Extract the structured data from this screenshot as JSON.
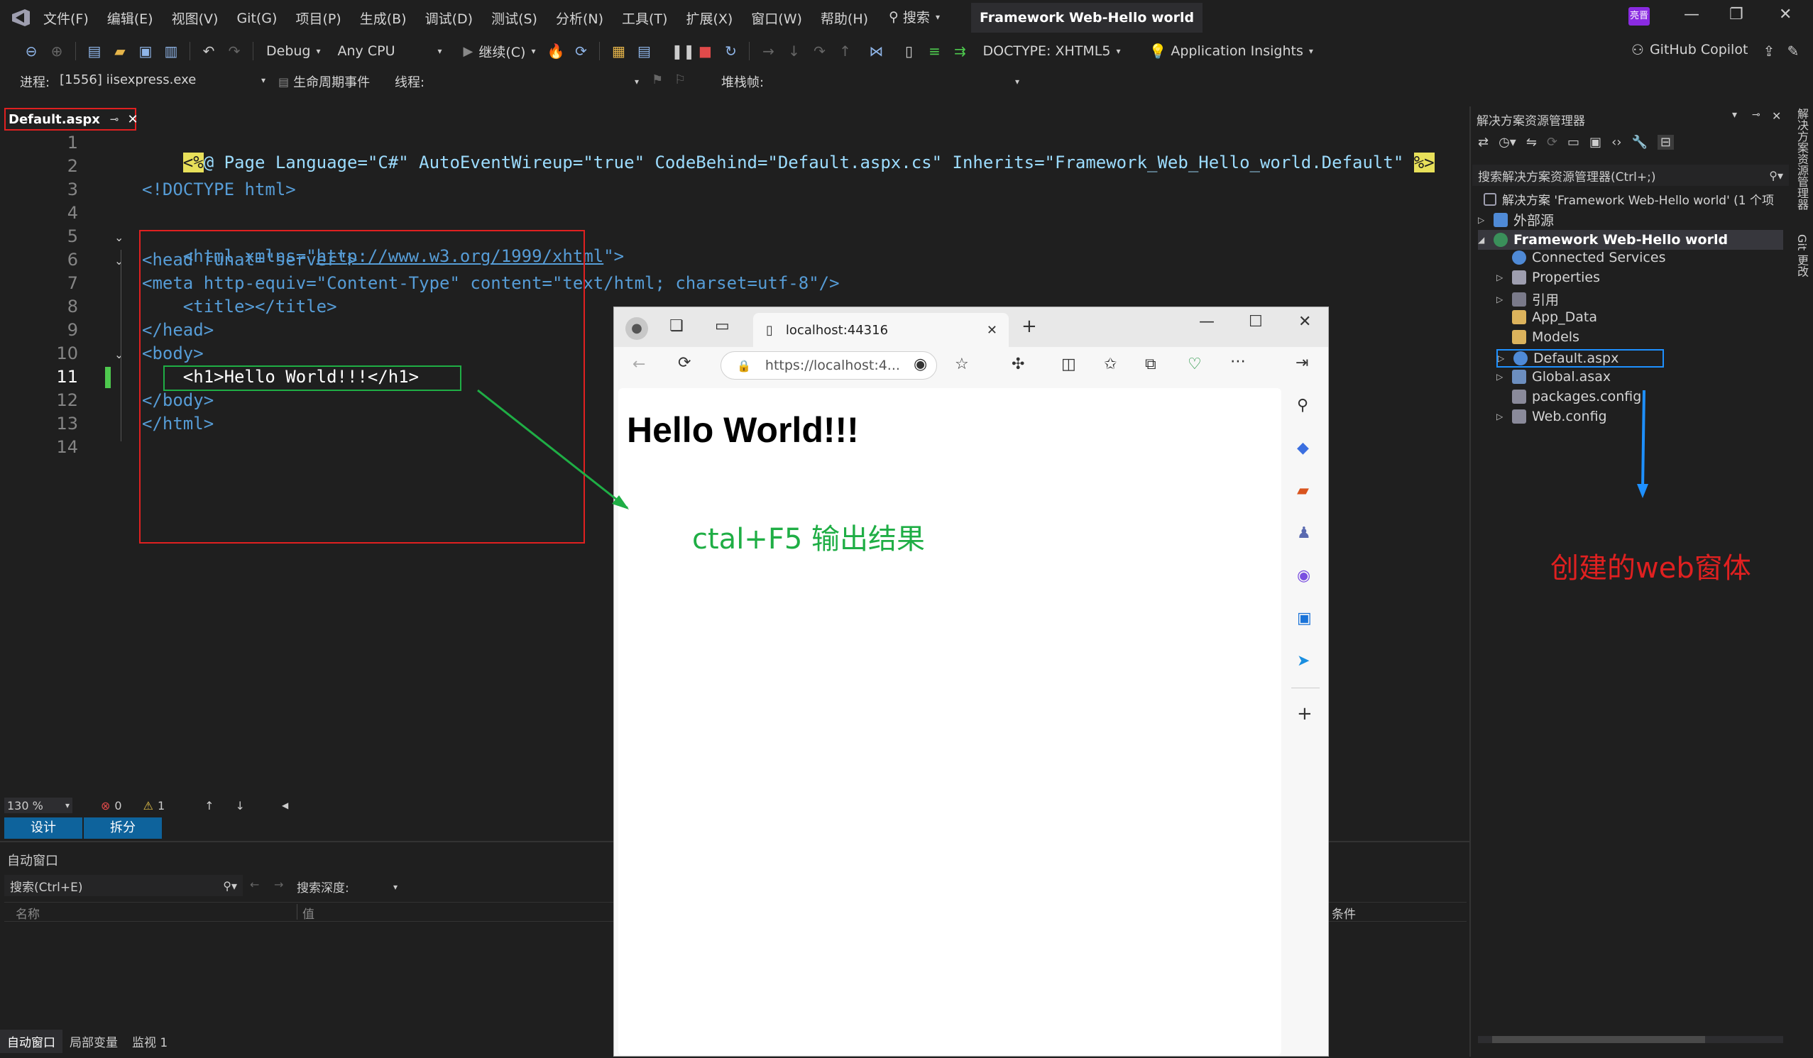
{
  "app": {
    "menu": [
      "文件(F)",
      "编辑(E)",
      "视图(V)",
      "Git(G)",
      "项目(P)",
      "生成(B)",
      "调试(D)",
      "测试(S)",
      "分析(N)",
      "工具(T)",
      "扩展(X)",
      "窗口(W)",
      "帮助(H)"
    ],
    "search_label": "搜索",
    "solution_title": "Framework Web-Hello world",
    "user_badge": "亮晋"
  },
  "toolbar": {
    "config": "Debug",
    "platform": "Any CPU",
    "continue": "继续(C)",
    "doctype": "DOCTYPE: XHTML5",
    "app_insights": "Application Insights",
    "copilot": "GitHub Copilot"
  },
  "debug_bar": {
    "process_label": "进程:",
    "process_value": "[1556] iisexpress.exe",
    "lifecycle": "生命周期事件",
    "thread_label": "线程:",
    "stack_label": "堆栈帧:"
  },
  "editor": {
    "tab_name": "Default.aspx",
    "line_numbers": [
      "1",
      "2",
      "3",
      "4",
      "5",
      "6",
      "7",
      "8",
      "9",
      "10",
      "11",
      "12",
      "13",
      "14"
    ],
    "current_line": "11",
    "lines": {
      "l1_open": "<%",
      "l1_rest": "@ Page Language=\"C#\" AutoEventWireup=\"true\" CodeBehind=\"Default.aspx.cs\" Inherits=\"Framework_Web_Hello_world.Default\" ",
      "l1_close": "%>",
      "l3": "<!DOCTYPE html>",
      "l5_a": "<html xmlns=\"",
      "l5_link": "http://www.w3.org/1999/xhtml",
      "l5_b": "\">",
      "l6": "<head runat=\"server\">",
      "l7": "<meta http-equiv=\"Content-Type\" content=\"text/html; charset=utf-8\"/>",
      "l8": "    <title></title>",
      "l9": "</head>",
      "l10": "<body>",
      "l11": "    <h1>Hello World!!!</h1>",
      "l12": "</body>",
      "l13": "</html>"
    },
    "zoom": "130 %",
    "errors": "0",
    "warnings": "1",
    "view_design": "设计",
    "view_split": "拆分"
  },
  "autos": {
    "title": "自动窗口",
    "search_placeholder": "搜索(Ctrl+E)",
    "depth_label": "搜索深度:",
    "col_name": "名称",
    "col_value": "值",
    "col_condition": "条件",
    "tabs": [
      "自动窗口",
      "局部变量",
      "监视 1"
    ]
  },
  "solution_explorer": {
    "title": "解决方案资源管理器",
    "search_placeholder": "搜索解决方案资源管理器(Ctrl+;)",
    "solution_line": "解决方案 'Framework Web-Hello world' (1 个项",
    "items": [
      {
        "label": "外部源",
        "icon": "folder-link-icon"
      },
      {
        "label": "Framework Web-Hello world",
        "icon": "web-project-icon"
      },
      {
        "label": "Connected Services",
        "icon": "connected-services-icon"
      },
      {
        "label": "Properties",
        "icon": "wrench-icon"
      },
      {
        "label": "引用",
        "icon": "references-icon"
      },
      {
        "label": "App_Data",
        "icon": "folder-icon"
      },
      {
        "label": "Models",
        "icon": "folder-icon"
      },
      {
        "label": "Default.aspx",
        "icon": "aspx-file-icon"
      },
      {
        "label": "Global.asax",
        "icon": "asax-file-icon"
      },
      {
        "label": "packages.config",
        "icon": "config-file-icon"
      },
      {
        "label": "Web.config",
        "icon": "config-file-icon"
      }
    ],
    "side_tabs": [
      "解决方案资源管理器",
      "Git 更改"
    ]
  },
  "browser": {
    "tab_title": "localhost:44316",
    "url": "https://localhost:4...",
    "page_heading": "Hello World!!!"
  },
  "annotations": {
    "green_note": "ctal+F5 输出结果",
    "red_note": "创建的web窗体",
    "green_color": "#1fae45",
    "red_color": "#e02020",
    "blue_color": "#1e90ff"
  }
}
